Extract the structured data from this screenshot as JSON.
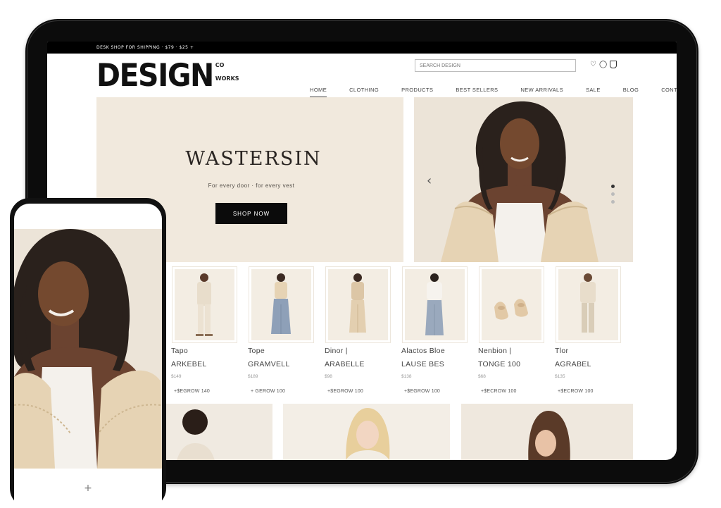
{
  "topbar": {
    "text": "DESK SHOP FOR SHIPPING · $79 · $25 +"
  },
  "header": {
    "logo_word": "DESIGN",
    "logo_small_1": "CO",
    "logo_small_2": "WORKS",
    "search_placeholder": "SEARCH DESIGN",
    "icons": [
      "heart-icon",
      "user-icon",
      "bag-icon"
    ]
  },
  "nav": {
    "items": [
      {
        "label": "HOME",
        "active": true
      },
      {
        "label": "CLOTHING"
      },
      {
        "label": "PRODUCTS"
      },
      {
        "label": "BEST SELLERS"
      },
      {
        "label": "NEW ARRIVALS"
      },
      {
        "label": "SALE"
      },
      {
        "label": "BLOG"
      },
      {
        "label": "CONTACT"
      }
    ]
  },
  "hero": {
    "title": "WASTERSIN",
    "subtitle": "For every door · for every vest",
    "button_label": "SHOP NOW"
  },
  "products": [
    {
      "name_1": "Tapo",
      "name_2": "ARKEBEL",
      "meta": "$149",
      "price": "+$EGROW 140",
      "look": "cream-suit"
    },
    {
      "name_1": "Tope",
      "name_2": "GRAMVELL",
      "meta": "$189",
      "price": "+ GEROW 100",
      "look": "denim-wide"
    },
    {
      "name_1": "Dinor |",
      "name_2": "ARABELLE",
      "meta": "$98",
      "price": "+$EGROW 100",
      "look": "beige-set"
    },
    {
      "name_1": "Alactos Bloe",
      "name_2": "LAUSE BES",
      "meta": "$138",
      "price": "+$EGROW 100",
      "look": "white-jeans"
    },
    {
      "name_1": "Nenbion |",
      "name_2": "TONGE 100",
      "meta": "$68",
      "price": "+$ECROW 100",
      "look": "shoes"
    },
    {
      "name_1": "Tlor",
      "name_2": "AGRABEL",
      "meta": "$135",
      "price": "+$ECROW 100",
      "look": "cream-shirt"
    }
  ],
  "phone": {
    "plus_label": "+"
  },
  "colors": {
    "hero_bg": "#f1e9dd",
    "card_bg": "#f3ede3",
    "accent": "#0b0b0b",
    "cream": "#e6d3b4",
    "skin": "#6b4330",
    "hair": "#2a211c"
  }
}
